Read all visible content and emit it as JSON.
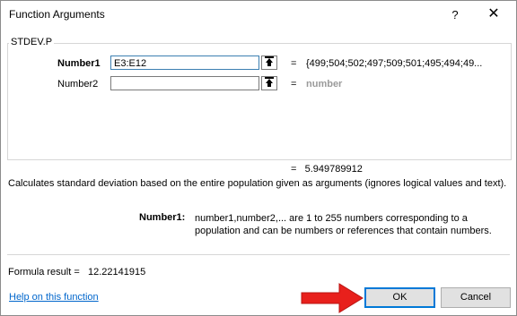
{
  "window": {
    "title": "Function Arguments",
    "help_glyph": "?",
    "close_glyph": "✕"
  },
  "function_name": "STDEV.P",
  "arguments": [
    {
      "label": "Number1",
      "value": "E3:E12",
      "equals": "=",
      "evaluated": "{499;504;502;497;509;501;495;494;49..."
    },
    {
      "label": "Number2",
      "value": "",
      "equals": "=",
      "evaluated": "number"
    }
  ],
  "result": {
    "equals": "=",
    "value": "5.949789912"
  },
  "description": "Calculates standard deviation based on the entire population given as arguments (ignores logical values and text).",
  "argument_help": {
    "name": "Number1:",
    "text": "number1,number2,... are 1 to 255 numbers corresponding to a population and can be numbers or references that contain numbers."
  },
  "formula_result": {
    "label": "Formula result =",
    "value": "12.22141915"
  },
  "help_link": "Help on this function",
  "buttons": {
    "ok": "OK",
    "cancel": "Cancel"
  },
  "colors": {
    "link": "#0066cc",
    "focus_border": "#0078d7",
    "annotation_arrow": "#e8201c"
  }
}
